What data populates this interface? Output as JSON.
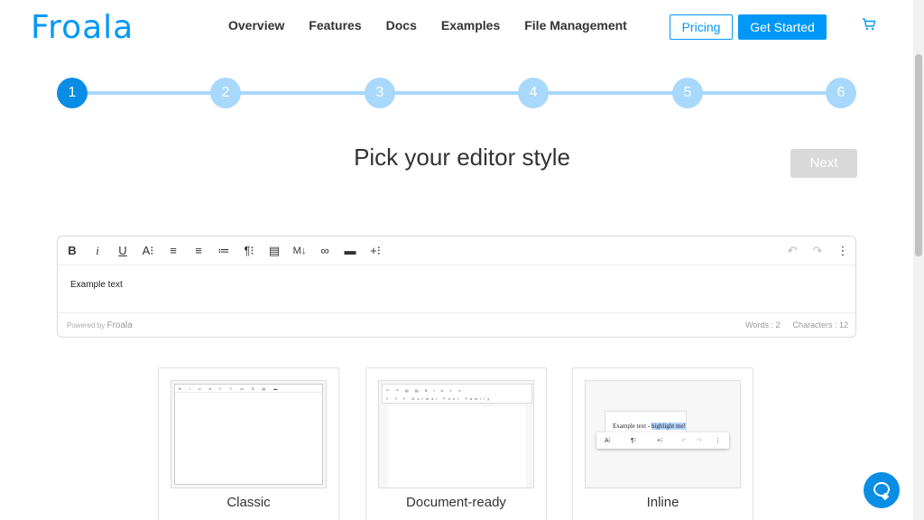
{
  "header": {
    "logo": "Froala",
    "nav": [
      "Overview",
      "Features",
      "Docs",
      "Examples",
      "File Management"
    ],
    "pricing_label": "Pricing",
    "get_started_label": "Get Started"
  },
  "stepper": {
    "steps": [
      "1",
      "2",
      "3",
      "4",
      "5",
      "6"
    ],
    "active_step": 1
  },
  "title": "Pick your editor style",
  "next_label": "Next",
  "editor": {
    "toolbar_left": [
      {
        "label": "B",
        "name": "bold-button"
      },
      {
        "label": "i",
        "name": "italic-button"
      },
      {
        "label": "U",
        "name": "underline-button"
      },
      {
        "label": "A⁝",
        "name": "text-color-button"
      },
      {
        "label": "≡",
        "name": "align-left-button"
      },
      {
        "label": "≡",
        "name": "align-center-button"
      },
      {
        "label": "≔",
        "name": "ordered-list-button"
      },
      {
        "label": "¶⁝",
        "name": "paragraph-format-button"
      },
      {
        "label": "▤",
        "name": "document-icon"
      },
      {
        "label": "M↓",
        "name": "markdown-button"
      },
      {
        "label": "∞",
        "name": "link-icon"
      },
      {
        "label": "▬",
        "name": "folder-icon"
      },
      {
        "label": "+⁝",
        "name": "more-insert-button"
      }
    ],
    "toolbar_right": [
      {
        "label": "↶",
        "name": "undo-icon"
      },
      {
        "label": "↷",
        "name": "redo-icon"
      },
      {
        "label": "⋮",
        "name": "more-options-icon"
      }
    ],
    "body_text": "Example text",
    "powered_by": "Powered by",
    "powered_logo": "Froala",
    "words": "Words : 2",
    "characters": "Characters : 12"
  },
  "cards": [
    {
      "label": "Classic",
      "toolbar": "B i U A ≡ ≡ ≔ ¶ ▤ ▬"
    },
    {
      "label": "Document-ready",
      "toolbar_1": "↶ ↷ ▤ ▤ B i U ≡ ∞",
      "toolbar_2": "≡ ≡ ≡ Normal Font Family"
    },
    {
      "label": "Inline",
      "text": "Example text -",
      "highlight": "highlight me!",
      "toolbar": [
        "A⁝",
        "¶⁝",
        "+⁝",
        "↶",
        "↷",
        "⋮"
      ]
    }
  ],
  "colors": {
    "brand": "#0098f7",
    "step_active": "#0a8de5",
    "step_inactive": "#a8d8fb"
  }
}
